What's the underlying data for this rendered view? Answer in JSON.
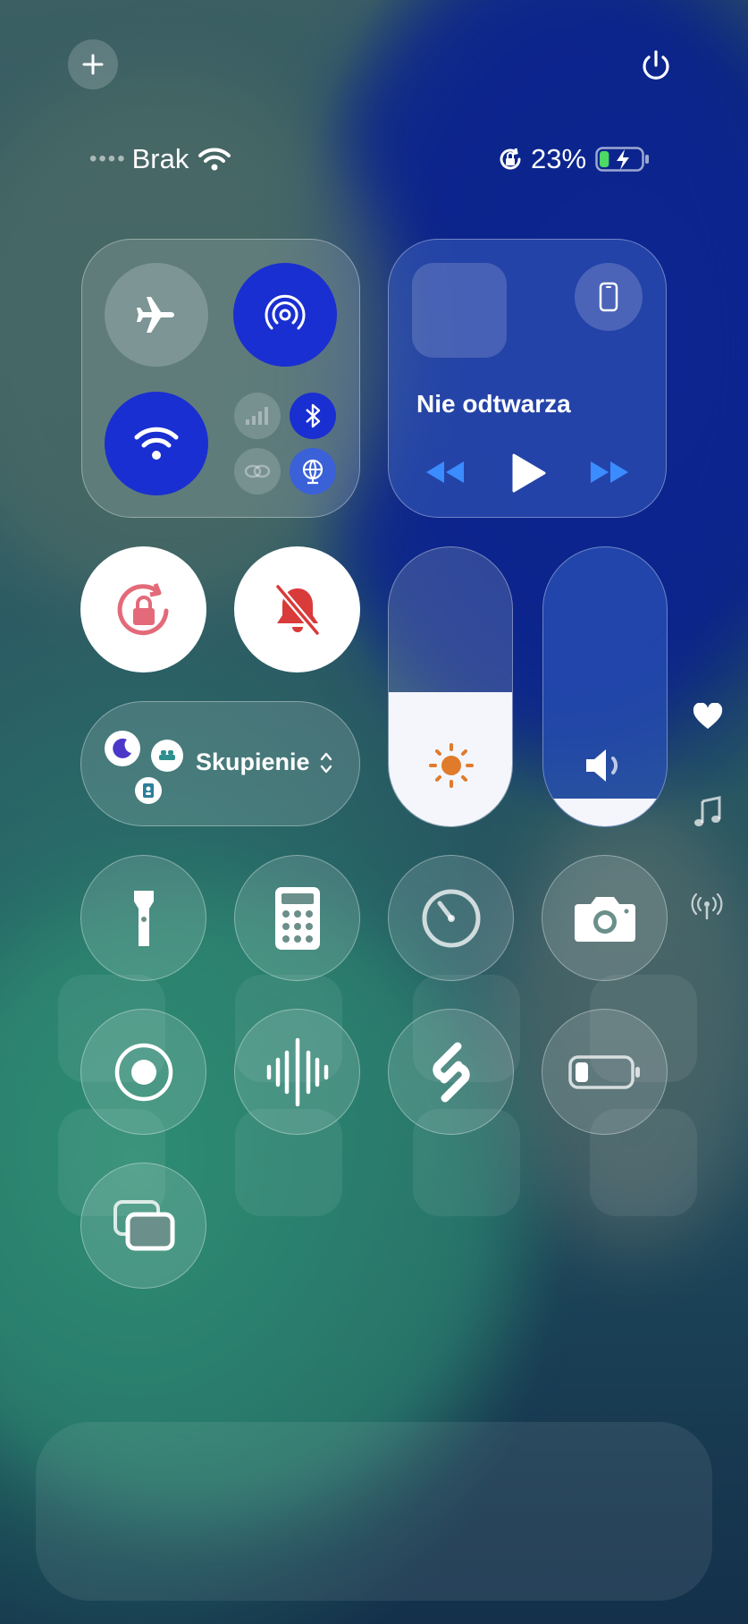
{
  "top_controls": {
    "add_icon": "plus-icon",
    "power_icon": "power-icon"
  },
  "status_bar": {
    "carrier": "Brak",
    "battery_percent": "23%",
    "battery_level": 0.23,
    "icons": [
      "wifi-icon",
      "orientation-lock-icon",
      "battery-charging-icon"
    ]
  },
  "connectivity": {
    "airplane": {
      "icon": "airplane-icon",
      "active": false
    },
    "airdrop": {
      "icon": "airdrop-icon",
      "active": true
    },
    "wifi": {
      "icon": "wifi-icon",
      "active": true
    },
    "cellular": {
      "icon": "cellular-icon",
      "active": false
    },
    "bluetooth": {
      "icon": "bluetooth-icon",
      "active": true
    },
    "hotspot": {
      "icon": "hotspot-icon",
      "active": false
    },
    "vpn": {
      "icon": "globe-icon",
      "active": true
    }
  },
  "media": {
    "title": "Nie odtwarza",
    "controls": [
      "rewind-icon",
      "play-icon",
      "fast-forward-icon"
    ],
    "output_icon": "iphone-icon",
    "accent": "#3b8cff"
  },
  "toggles": {
    "orientation_lock": {
      "icon": "orientation-lock-icon",
      "color": "#e36a78"
    },
    "silent_mode": {
      "icon": "bell-slash-icon",
      "color": "#d93a3a"
    }
  },
  "focus": {
    "label": "Skupienie",
    "icons": [
      "moon-icon",
      "bed-icon",
      "badge-icon"
    ]
  },
  "sliders": {
    "brightness": {
      "level": 0.48,
      "icon": "sun-icon",
      "color": "#e07b2b"
    },
    "volume": {
      "level": 0.1,
      "icon": "speaker-icon"
    }
  },
  "side_icons": [
    "heart-icon",
    "music-note-icon",
    "antenna-icon"
  ],
  "grid_buttons": [
    "flashlight-icon",
    "calculator-icon",
    "timer-icon",
    "camera-icon",
    "screen-record-icon",
    "voice-memo-icon",
    "shazam-icon",
    "low-power-battery-icon",
    "screen-mirroring-icon"
  ]
}
